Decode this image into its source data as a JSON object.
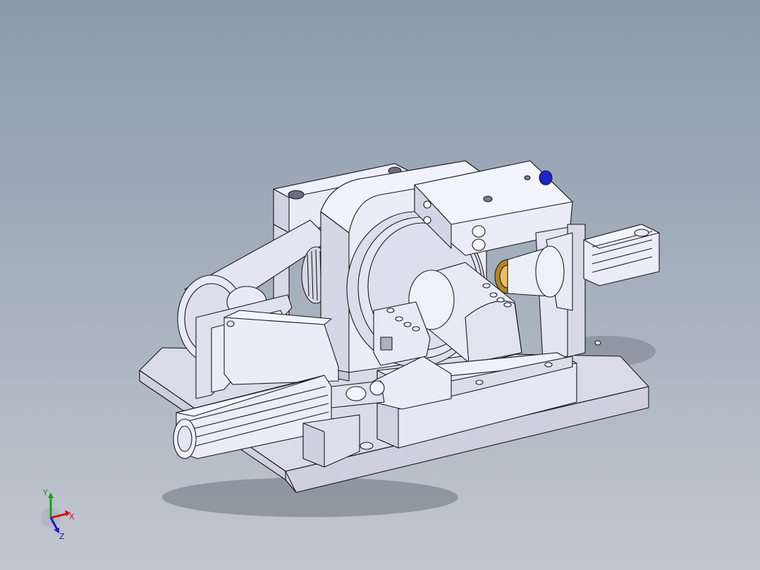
{
  "viewport": {
    "background_top": "#8b9aad",
    "background_bottom": "#c1c7cf",
    "model_face_color": "#e6e6f4",
    "model_edge_color": "#1c1c22"
  },
  "triad": {
    "x_label": "X",
    "y_label": "Y",
    "z_label": "Z",
    "x_color": "#d01818",
    "y_color": "#18a018",
    "z_color": "#1a1ad0"
  }
}
